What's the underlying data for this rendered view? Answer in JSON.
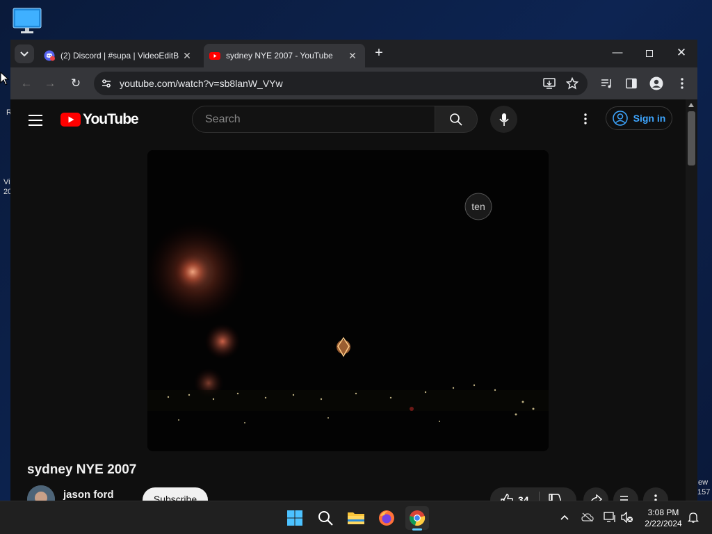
{
  "desktop": {
    "frag_left_1": "R",
    "frag_left_2": "Vi",
    "frag_left_3": "20",
    "frag_right_1": "ew",
    "frag_right_2": "157"
  },
  "browser": {
    "tabs": [
      {
        "title": "(2) Discord | #supa | VideoEditB",
        "icon": "discord-icon",
        "active": false
      },
      {
        "title": "sydney NYE 2007 - YouTube",
        "icon": "youtube-icon",
        "active": true
      }
    ],
    "url": "youtube.com/watch?v=sb8lanW_VYw"
  },
  "youtube": {
    "logo_text": "YouTube",
    "search_placeholder": "Search",
    "sign_in_label": "Sign in",
    "video": {
      "title": "sydney NYE 2007",
      "watermark": "ten",
      "channel_name": "jason ford",
      "subscribe_label": "Subscribe",
      "likes": "34"
    }
  },
  "taskbar": {
    "apps": [
      "start-icon",
      "search-icon",
      "file-explorer-icon",
      "firefox-icon",
      "chrome-icon"
    ],
    "time": "3:08 PM",
    "date": "2/22/2024"
  },
  "colors": {
    "accent_blue": "#3ea6ff",
    "youtube_red": "#ff0000",
    "page_bg": "#0f0f0f"
  }
}
